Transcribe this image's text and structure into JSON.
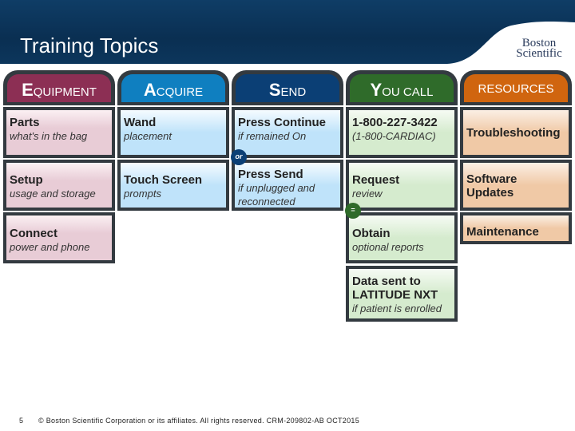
{
  "header": {
    "title": "Training Topics",
    "logo": "Boston Scientific"
  },
  "columns": [
    {
      "initial": "E",
      "rest": "quipment",
      "color": "#8c2f54"
    },
    {
      "initial": "A",
      "rest": "cquire",
      "color": "#0f7fc0"
    },
    {
      "initial": "S",
      "rest": "end",
      "color": "#0b3f75"
    },
    {
      "initial": "Y",
      "rest": "ou call",
      "color": "#2f6b2a"
    },
    {
      "initial": "",
      "rest": "Resources",
      "color": "#d0650f"
    }
  ],
  "equipment": [
    {
      "title": "Parts",
      "sub": "what's in the bag"
    },
    {
      "title": "Setup",
      "sub": "usage and storage"
    },
    {
      "title": "Connect",
      "sub": "power and phone"
    }
  ],
  "acquire": [
    {
      "title": "Wand",
      "sub": "placement"
    },
    {
      "title": "Touch Screen",
      "sub": "prompts"
    }
  ],
  "send": [
    {
      "title": "Press Continue",
      "sub": "if remained On"
    },
    {
      "title": "Press Send",
      "sub": "if unplugged and reconnected"
    }
  ],
  "send_connector": "or",
  "you_call": [
    {
      "title": "1-800-227-3422",
      "sub": "(1-800-CARDIAC)"
    },
    {
      "title": "Request",
      "sub": "review"
    },
    {
      "title": "Obtain",
      "sub": "optional reports"
    },
    {
      "title": "Data sent to LATITUDE NXT",
      "sub": "if patient is enrolled"
    }
  ],
  "resources": [
    {
      "title": "Troubleshooting"
    },
    {
      "title": "Software Updates"
    },
    {
      "title": "Maintenance"
    }
  ],
  "footer": {
    "page": "5",
    "copyright": "© Boston Scientific Corporation or its affiliates.  All rights reserved.   CRM-209802-AB OCT2015"
  }
}
